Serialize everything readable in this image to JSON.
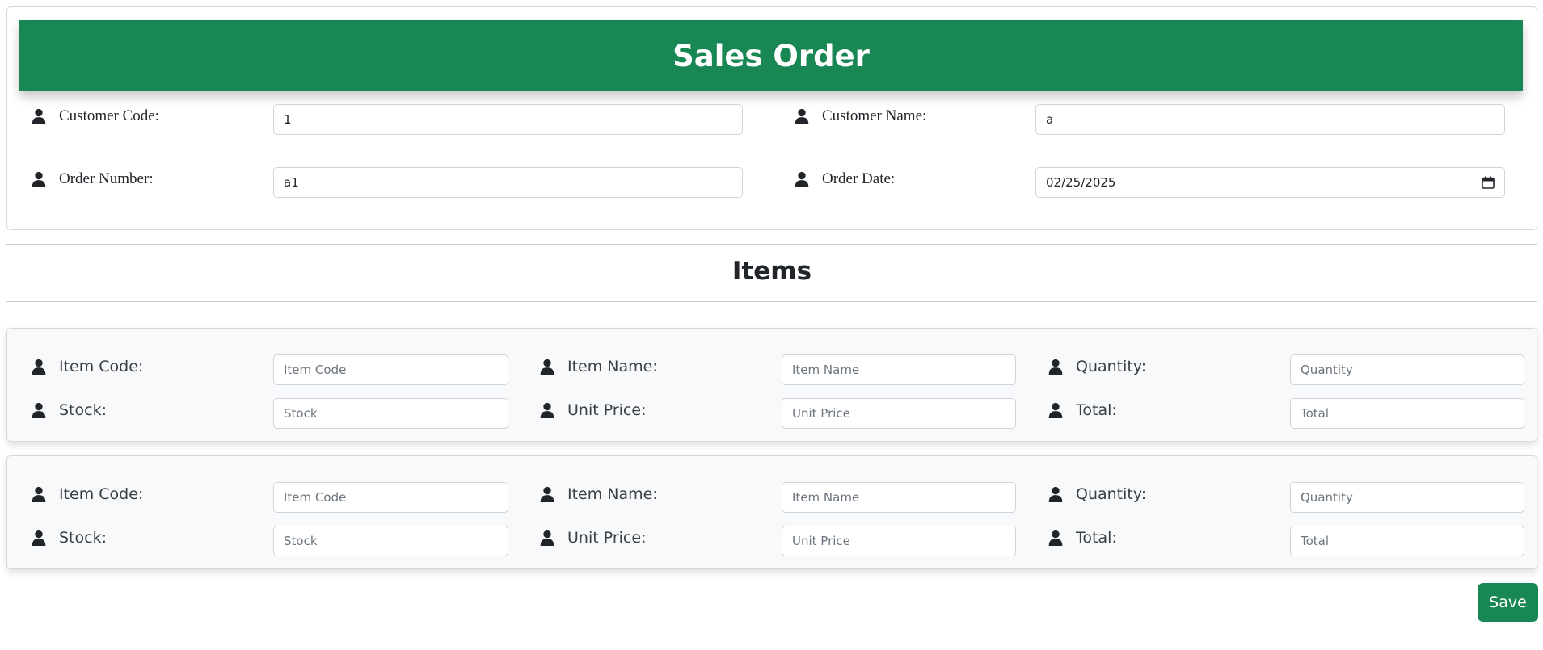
{
  "order": {
    "title": "Sales Order",
    "fields": [
      {
        "label": "Customer Code:",
        "value": "1"
      },
      {
        "label": "Customer Name:",
        "value": "a"
      },
      {
        "label": "Order Number:",
        "value": "a1"
      },
      {
        "label": "Order Date:",
        "value": "02/25/2025"
      }
    ]
  },
  "items_section": {
    "title": "Items"
  },
  "item_rows": [
    {
      "fields": [
        {
          "label": "Item Code:",
          "placeholder": "Item Code"
        },
        {
          "label": "Item Name:",
          "placeholder": "Item Name"
        },
        {
          "label": "Quantity:",
          "placeholder": "Quantity"
        },
        {
          "label": "Stock:",
          "placeholder": "Stock"
        },
        {
          "label": "Unit Price:",
          "placeholder": "Unit Price"
        },
        {
          "label": "Total:",
          "placeholder": "Total"
        }
      ]
    },
    {
      "fields": [
        {
          "label": "Item Code:",
          "placeholder": "Item Code"
        },
        {
          "label": "Item Name:",
          "placeholder": "Item Name"
        },
        {
          "label": "Quantity:",
          "placeholder": "Quantity"
        },
        {
          "label": "Stock:",
          "placeholder": "Stock"
        },
        {
          "label": "Unit Price:",
          "placeholder": "Unit Price"
        },
        {
          "label": "Total:",
          "placeholder": "Total"
        }
      ]
    }
  ],
  "actions": {
    "save_label": "Save"
  },
  "icons": {
    "field_icon": "person-icon",
    "date_icon": "calendar-icon"
  },
  "colors": {
    "accent": "#198754",
    "card_bg": "#f8f9fa",
    "border": "#ced4da"
  }
}
